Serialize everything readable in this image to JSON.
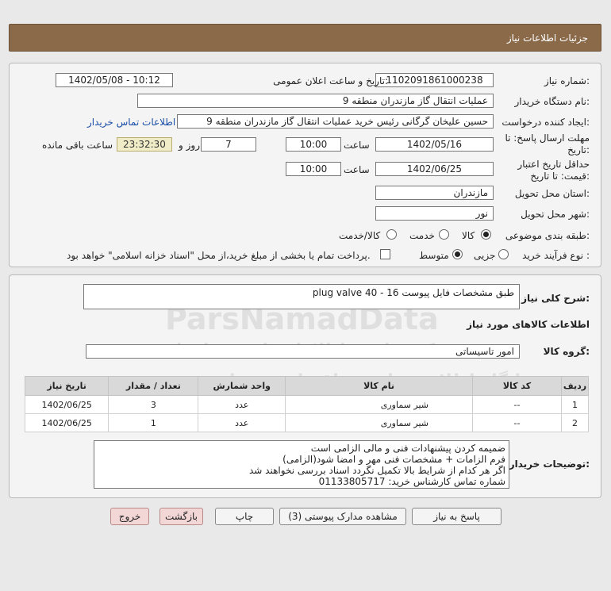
{
  "header": {
    "title": "جزئیات اطلاعات نیاز"
  },
  "form": {
    "need_number": {
      "label": "شماره نیاز:",
      "value": "1102091861000238"
    },
    "announce": {
      "label": "تاریخ و ساعت اعلان عمومی:",
      "value": "1402/05/08 - 10:12"
    },
    "buyer_org": {
      "label": "نام دستگاه خریدار:",
      "value": "عملیات انتقال گاز مازندران منطقه 9"
    },
    "requester": {
      "label": "ایجاد کننده درخواست:",
      "value": "حسین علیخان گرگانی رئیس خرید عملیات انتقال گاز مازندران منطقه 9"
    },
    "contact_link": "اطلاعات تماس خریدار",
    "deadline": {
      "label_line1": "مهلت ارسال پاسخ: تا",
      "label_line2": "تاریخ:",
      "date": "1402/05/16",
      "time_label": "ساعت",
      "time": "10:00",
      "days": "7",
      "days_label": "روز و",
      "remaining": "23:32:30",
      "remaining_label": "ساعت باقی مانده"
    },
    "validity": {
      "label_line1": "حداقل تاریخ اعتبار",
      "label_line2": "قیمت: تا تاریخ:",
      "date": "1402/06/25",
      "time_label": "ساعت",
      "time": "10:00"
    },
    "province": {
      "label": "استان محل تحویل:",
      "value": "مازندران"
    },
    "city": {
      "label": "شهر محل تحویل:",
      "value": "نور"
    },
    "category": {
      "label": "طبقه بندی موضوعی:",
      "options": [
        "کالا",
        "خدمت",
        "کالا/خدمت"
      ],
      "selected": "کالا"
    },
    "process": {
      "label": "نوع فرآیند خرید :",
      "options": [
        "جزیی",
        "متوسط"
      ],
      "selected": "متوسط",
      "treasury_note": "پرداخت تمام یا بخشی از مبلغ خرید،از محل \"اسناد خزانه اسلامی\" خواهد بود."
    }
  },
  "description": {
    "label": "شرح کلی نیاز:",
    "value": "plug valve 40 - 16 طبق مشخصات فایل پیوست"
  },
  "goods": {
    "section_title": "اطلاعات کالاهای مورد نیاز",
    "group_label": "گروه کالا:",
    "group_value": "امور تاسیساتی",
    "columns": [
      "ردیف",
      "کد کالا",
      "نام کالا",
      "واحد شمارش",
      "تعداد / مقدار",
      "تاریخ نیاز"
    ],
    "rows": [
      [
        "1",
        "--",
        "شیر سماوری",
        "عدد",
        "3",
        "1402/06/25"
      ],
      [
        "2",
        "--",
        "شیر سماوری",
        "عدد",
        "1",
        "1402/06/25"
      ]
    ]
  },
  "buyer_notes": {
    "label": "توضیحات خریدار:",
    "lines": [
      "ضمیمه کردن پیشنهادات فنی و مالی الزامی است",
      "فرم الزامات + مشخصات فنی مهر و امضا شود(الزامی)",
      "اگر هر کدام از شرایط بالا تکمیل نگردد اسناد بررسی نخواهند شد",
      "شماره تماس کارشناس خرید: 01133805717"
    ]
  },
  "buttons": {
    "reply": "پاسخ به نیاز",
    "docs": "مشاهده مدارک پیوستی (3)",
    "print": "چاپ",
    "back": "بازگشت",
    "exit": "خروج"
  },
  "watermark": {
    "brand": "ParsNamadData",
    "tagline": "مرکز فراوری اطلاعات پارس نماد داده",
    "portal": "پایگاه اطلاع رسانی مناقصات و مزایده",
    "phone": "۰۲۱-۸۸۳۴۹۶۷۰-۵"
  }
}
